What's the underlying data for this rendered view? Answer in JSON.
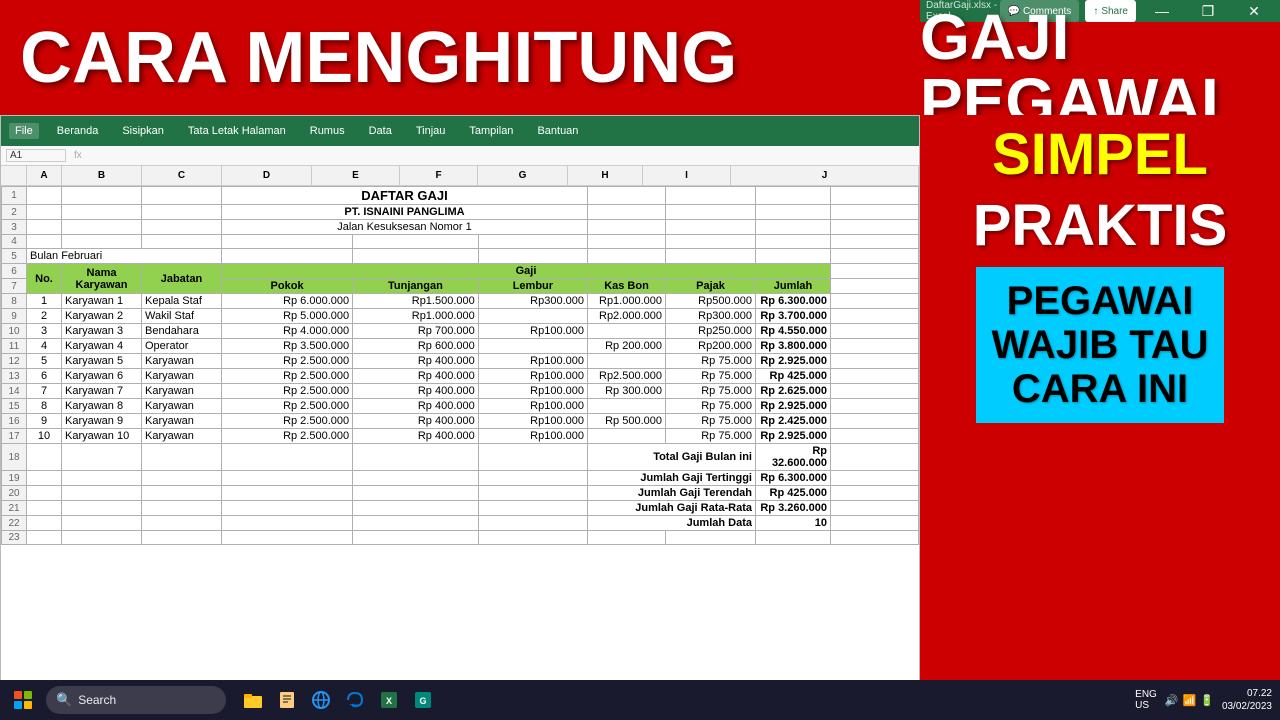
{
  "banner": {
    "left_text": "CARA MENGHITUNG",
    "right_line1": "GAJI PEGAWAI"
  },
  "right_panel": {
    "line1": "SIMPEL",
    "line2": "PRAKTIS",
    "cyan_line1": "PEGAWAI",
    "cyan_line2": "WAJIB TAU",
    "cyan_line3": "CARA INI"
  },
  "excel": {
    "title": "DaftarGaji.xlsx - Excel",
    "ribbon_tabs": [
      "File",
      "Beranda",
      "Sisipkan",
      "Tata Letak Halaman",
      "Rumus",
      "Data",
      "Tinjau",
      "Tampilan",
      "Bantuan"
    ],
    "comments_label": "Comments",
    "share_label": "Share",
    "name_box": "A1"
  },
  "spreadsheet": {
    "col_headers": [
      "A",
      "B",
      "C",
      "D",
      "E",
      "F",
      "G",
      "H",
      "I"
    ],
    "header_row1": {
      "title": "DAFTAR GAJI"
    },
    "header_row2": {
      "subtitle": "PT. ISNAINI PANGLIMA"
    },
    "header_row3": {
      "subtitle2": "Jalan Kesuksesan Nomor 1"
    },
    "row5": {
      "text": "Bulan Februari"
    },
    "row6": {
      "no": "No.",
      "nama": "Nama Karyawan",
      "jabatan": "Jabatan",
      "gaji": "Gaji"
    },
    "row7": {
      "pokok": "Pokok",
      "tunjangan": "Tunjangan",
      "lembur": "Lembur",
      "kas_bon": "Kas Bon",
      "pajak": "Pajak",
      "jumlah": "Jumlah"
    },
    "employees": [
      {
        "no": 1,
        "nama": "Karyawan 1",
        "jabatan": "Kepala Staf",
        "pokok": "Rp  6.000.000",
        "tunjangan": "Rp1.500.000",
        "lembur": "Rp300.000",
        "kas_bon": "Rp1.000.000",
        "pajak": "Rp500.000",
        "jumlah": "Rp  6.300.000"
      },
      {
        "no": 2,
        "nama": "Karyawan 2",
        "jabatan": "Wakil Staf",
        "pokok": "Rp  5.000.000",
        "tunjangan": "Rp1.000.000",
        "lembur": "",
        "kas_bon": "Rp2.000.000",
        "pajak": "Rp300.000",
        "jumlah": "Rp  3.700.000"
      },
      {
        "no": 3,
        "nama": "Karyawan 3",
        "jabatan": "Bendahara",
        "pokok": "Rp  4.000.000",
        "tunjangan": "Rp   700.000",
        "lembur": "Rp100.000",
        "kas_bon": "",
        "pajak": "Rp250.000",
        "jumlah": "Rp  4.550.000"
      },
      {
        "no": 4,
        "nama": "Karyawan 4",
        "jabatan": "Operator",
        "pokok": "Rp  3.500.000",
        "tunjangan": "Rp   600.000",
        "lembur": "",
        "kas_bon": "Rp   200.000",
        "pajak": "Rp200.000",
        "jumlah": "Rp  3.800.000"
      },
      {
        "no": 5,
        "nama": "Karyawan 5",
        "jabatan": "Karyawan",
        "pokok": "Rp  2.500.000",
        "tunjangan": "Rp   400.000",
        "lembur": "Rp100.000",
        "kas_bon": "",
        "pajak": "Rp  75.000",
        "jumlah": "Rp  2.925.000"
      },
      {
        "no": 6,
        "nama": "Karyawan 6",
        "jabatan": "Karyawan",
        "pokok": "Rp  2.500.000",
        "tunjangan": "Rp   400.000",
        "lembur": "Rp100.000",
        "kas_bon": "Rp2.500.000",
        "pajak": "Rp  75.000",
        "jumlah": "Rp     425.000"
      },
      {
        "no": 7,
        "nama": "Karyawan 7",
        "jabatan": "Karyawan",
        "pokok": "Rp  2.500.000",
        "tunjangan": "Rp   400.000",
        "lembur": "Rp100.000",
        "kas_bon": "Rp   300.000",
        "pajak": "Rp  75.000",
        "jumlah": "Rp  2.625.000"
      },
      {
        "no": 8,
        "nama": "Karyawan 8",
        "jabatan": "Karyawan",
        "pokok": "Rp  2.500.000",
        "tunjangan": "Rp   400.000",
        "lembur": "Rp100.000",
        "kas_bon": "",
        "pajak": "Rp  75.000",
        "jumlah": "Rp  2.925.000"
      },
      {
        "no": 9,
        "nama": "Karyawan 9",
        "jabatan": "Karyawan",
        "pokok": "Rp  2.500.000",
        "tunjangan": "Rp   400.000",
        "lembur": "Rp100.000",
        "kas_bon": "Rp   500.000",
        "pajak": "Rp  75.000",
        "jumlah": "Rp  2.425.000"
      },
      {
        "no": 10,
        "nama": "Karyawan 10",
        "jabatan": "Karyawan",
        "pokok": "Rp  2.500.000",
        "tunjangan": "Rp   400.000",
        "lembur": "Rp100.000",
        "kas_bon": "",
        "pajak": "Rp  75.000",
        "jumlah": "Rp  2.925.000"
      }
    ],
    "summaries": [
      {
        "label": "Total Gaji Bulan ini",
        "value": "Rp 32.600.000"
      },
      {
        "label": "Jumlah Gaji Tertinggi",
        "value": "Rp  6.300.000"
      },
      {
        "label": "Jumlah Gaji Terendah",
        "value": "Rp     425.000"
      },
      {
        "label": "Jumlah Gaji Rata-Rata",
        "value": "Rp  3.260.000"
      },
      {
        "label": "Jumlah Data",
        "value": "10"
      }
    ]
  },
  "taskbar": {
    "search_placeholder": "Search",
    "time": "07.22",
    "date": "03/02/2023",
    "lang_top": "ENG",
    "lang_bottom": "US"
  }
}
